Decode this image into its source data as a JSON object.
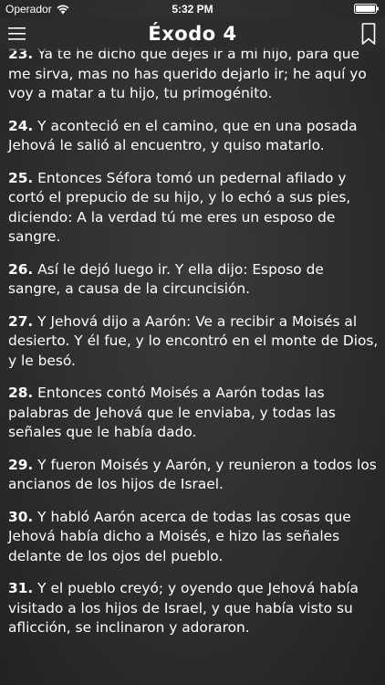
{
  "status_bar": {
    "carrier": "Operador",
    "time": "5:32 PM"
  },
  "nav": {
    "title": "Éxodo 4",
    "menu_icon": "hamburger-menu-icon",
    "bookmark_icon": "bookmark-icon"
  },
  "verses": [
    {
      "number": "23.",
      "text": " Ya te he dicho que dejes ir a mi hijo, para que me sirva, mas no has querido dejarlo ir; he aquí yo voy a matar a tu hijo, tu primogénito."
    },
    {
      "number": "24.",
      "text": " Y aconteció en el camino, que en una posada Jehová le salió al encuentro, y quiso matarlo."
    },
    {
      "number": "25.",
      "text": " Entonces Séfora tomó un pedernal afilado y cortó el prepucio de su hijo, y lo echó a sus pies, diciendo: A la verdad tú me eres un esposo de sangre."
    },
    {
      "number": "26.",
      "text": " Así le dejó luego ir. Y ella dijo: Esposo de sangre, a causa de la circuncisión."
    },
    {
      "number": "27.",
      "text": " Y Jehová dijo a Aarón: Ve a recibir a Moisés al desierto. Y él fue, y lo encontró en el monte de Dios, y le besó."
    },
    {
      "number": "28.",
      "text": " Entonces contó Moisés a Aarón todas las palabras de Jehová que le enviaba, y todas las señales que le había dado."
    },
    {
      "number": "29.",
      "text": " Y fueron Moisés y Aarón, y reunieron a todos los ancianos de los hijos de Israel."
    },
    {
      "number": "30.",
      "text": " Y habló Aarón acerca de todas las cosas que Jehová había dicho a Moisés, e hizo las señales delante de los ojos del pueblo."
    },
    {
      "number": "31.",
      "text": " Y el pueblo creyó; y oyendo que Jehová había visitado a los hijos de Israel, y que había visto su aflicción, se inclinaron y adoraron."
    }
  ],
  "colors": {
    "background": "#2e2e2e",
    "text": "#ffffff"
  }
}
